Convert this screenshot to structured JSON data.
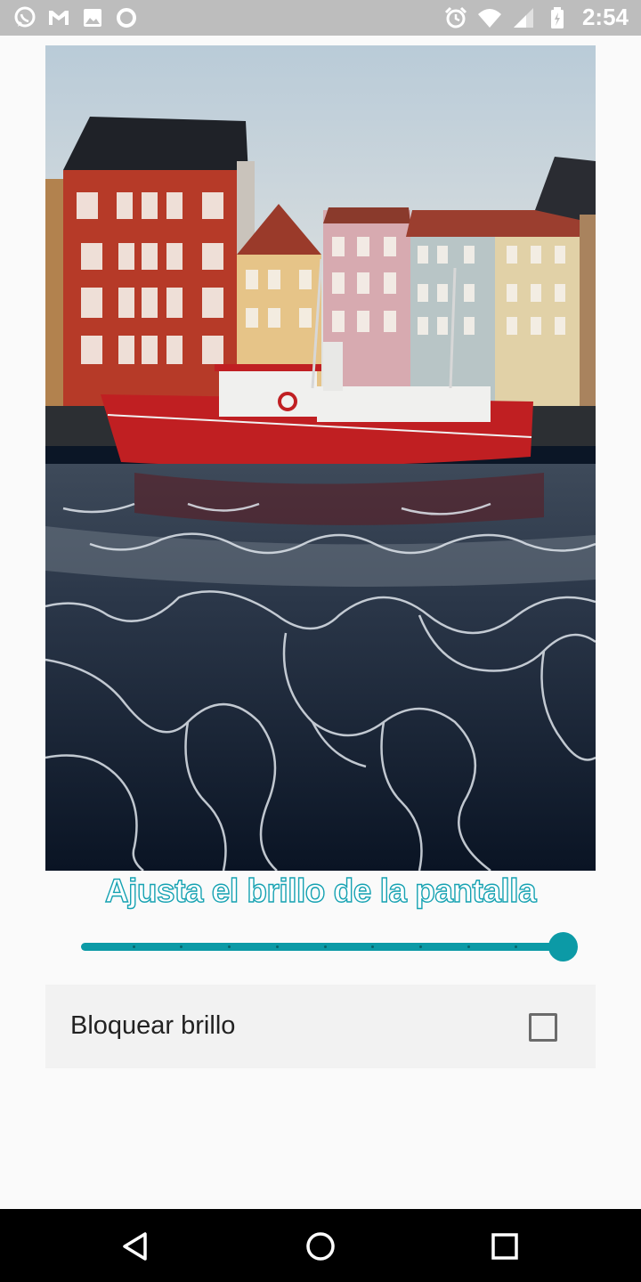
{
  "status_bar": {
    "time": "2:54",
    "left_icons": [
      "whatsapp-icon",
      "gmail-icon",
      "image-icon",
      "circle-icon"
    ],
    "right_icons": [
      "alarm-icon",
      "wifi-icon",
      "signal-icon",
      "battery-icon"
    ]
  },
  "photo": {
    "description_icon": "harbor-boat-photo"
  },
  "title": "Ajusta el brillo de la pantalla",
  "slider": {
    "value": 1.0,
    "ticks": 9,
    "accent": "#0c9aa6"
  },
  "lock": {
    "label": "Bloquear brillo",
    "checked": false
  },
  "nav_bar": {
    "buttons": [
      "back-icon",
      "home-icon",
      "recents-icon"
    ]
  }
}
